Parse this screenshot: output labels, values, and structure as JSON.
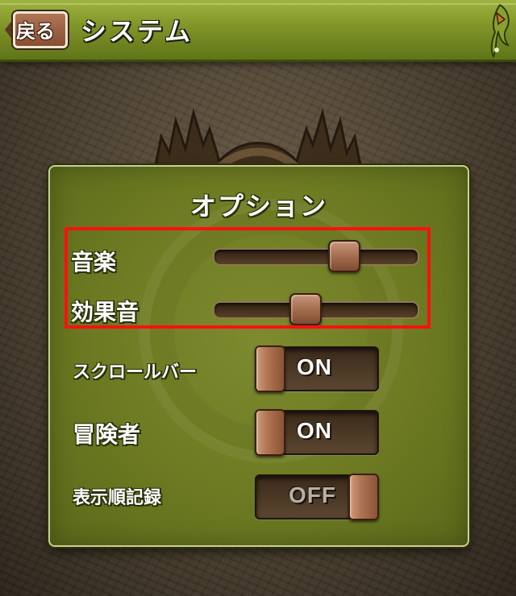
{
  "header": {
    "back_label": "戻る",
    "title": "システム"
  },
  "panel": {
    "title": "オプション",
    "sliders": [
      {
        "label": "音楽",
        "value_fraction": 0.66
      },
      {
        "label": "効果音",
        "value_fraction": 0.44
      }
    ],
    "toggles": [
      {
        "label": "スクロールバー",
        "state": "ON"
      },
      {
        "label": "冒険者",
        "state": "ON"
      },
      {
        "label": "表示順記録",
        "state": "OFF"
      }
    ]
  },
  "colors": {
    "header_green": "#7f9428",
    "panel_green": "#6d7a22",
    "knob_brown": "#a06a4c",
    "highlight_red": "#ff1010"
  },
  "icons": {
    "back": "left-arrow-icon",
    "corner": "dragon-icon"
  }
}
